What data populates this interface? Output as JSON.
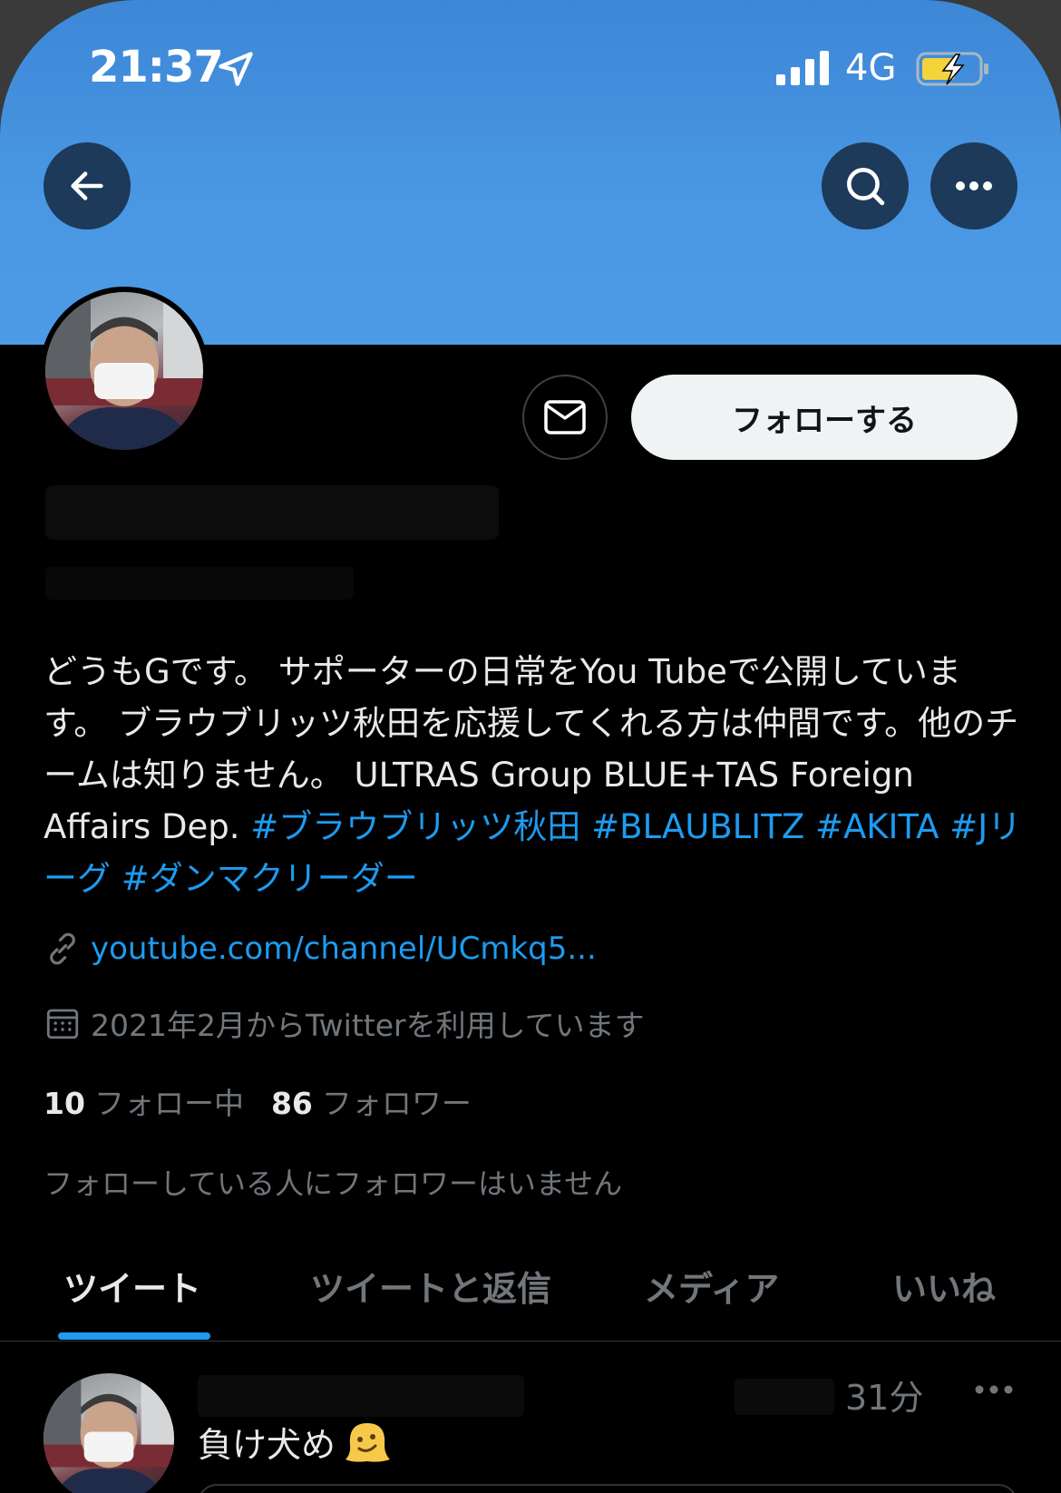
{
  "status_bar": {
    "time": "21:37",
    "network": "4G"
  },
  "profile": {
    "follow_label": "フォローする",
    "bio_text": "どうもGです。 サポーターの日常をYou Tubeで公開しています。 ブラウブリッツ秋田を応援してくれる方は仲間です。他のチームは知りません。 ULTRAS Group BLUE+TAS Foreign Affairs Dep. ",
    "hashtags": [
      "#ブラウブリッツ秋田",
      "#BLAUBLITZ",
      "#AKITA",
      "#Jリーグ",
      "#ダンマクリーダー"
    ],
    "link": "youtube.com/channel/UCmkq5...",
    "joined": "2021年2月からTwitterを利用しています",
    "following_count": "10",
    "following_label": "フォロー中",
    "followers_count": "86",
    "followers_label": "フォロワー",
    "no_mutual": "フォローしている人にフォロワーはいません"
  },
  "tabs": [
    {
      "label": "ツイート",
      "active": true
    },
    {
      "label": "ツイートと返信",
      "active": false
    },
    {
      "label": "メディア",
      "active": false
    },
    {
      "label": "いいね",
      "active": false
    }
  ],
  "tweet": {
    "time": "31分",
    "text": "負け犬め"
  },
  "colors": {
    "accent": "#1d9bf0",
    "banner": "#4a98e4",
    "background": "#000000"
  }
}
